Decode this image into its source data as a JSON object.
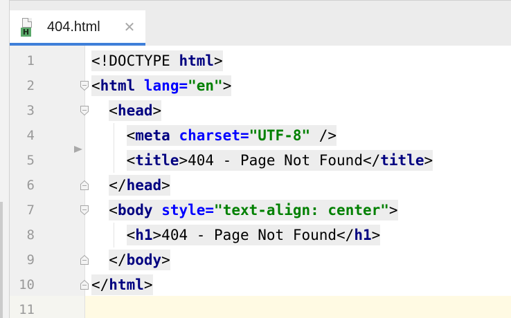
{
  "tab": {
    "filename": "404.html",
    "file_icon_letter": "H",
    "close_glyph": "✕"
  },
  "editor": {
    "line_numbers": [
      "1",
      "2",
      "3",
      "4",
      "5",
      "6",
      "7",
      "8",
      "9",
      "10",
      "11"
    ],
    "lines": [
      [
        {
          "t": "<!DOCTYPE ",
          "c": "plain"
        },
        {
          "t": "html",
          "c": "tag"
        },
        {
          "t": ">",
          "c": "plain"
        }
      ],
      [
        {
          "t": "<",
          "c": "plain"
        },
        {
          "t": "html",
          "c": "tag"
        },
        {
          "t": " ",
          "c": "plain"
        },
        {
          "t": "lang=",
          "c": "attr"
        },
        {
          "t": "\"en\"",
          "c": "str"
        },
        {
          "t": ">",
          "c": "plain"
        }
      ],
      [
        {
          "t": "  <",
          "c": "plain"
        },
        {
          "t": "head",
          "c": "tag"
        },
        {
          "t": ">",
          "c": "plain"
        }
      ],
      [
        {
          "t": "    <",
          "c": "plain"
        },
        {
          "t": "meta",
          "c": "tag"
        },
        {
          "t": " ",
          "c": "plain"
        },
        {
          "t": "charset=",
          "c": "attr"
        },
        {
          "t": "\"UTF-8\"",
          "c": "str"
        },
        {
          "t": " />",
          "c": "plain"
        }
      ],
      [
        {
          "t": "    <",
          "c": "plain"
        },
        {
          "t": "title",
          "c": "tag"
        },
        {
          "t": ">404 - Page Not Found</",
          "c": "plain"
        },
        {
          "t": "title",
          "c": "tag"
        },
        {
          "t": ">",
          "c": "plain"
        }
      ],
      [
        {
          "t": "  </",
          "c": "plain"
        },
        {
          "t": "head",
          "c": "tag"
        },
        {
          "t": ">",
          "c": "plain"
        }
      ],
      [
        {
          "t": "  <",
          "c": "plain"
        },
        {
          "t": "body",
          "c": "tag"
        },
        {
          "t": " ",
          "c": "plain"
        },
        {
          "t": "style=",
          "c": "attr"
        },
        {
          "t": "\"text-align: center\"",
          "c": "str"
        },
        {
          "t": ">",
          "c": "plain"
        }
      ],
      [
        {
          "t": "    <",
          "c": "plain"
        },
        {
          "t": "h1",
          "c": "tag"
        },
        {
          "t": ">404 - Page Not Found</",
          "c": "plain"
        },
        {
          "t": "h1",
          "c": "tag"
        },
        {
          "t": ">",
          "c": "plain"
        }
      ],
      [
        {
          "t": "  </",
          "c": "plain"
        },
        {
          "t": "body",
          "c": "tag"
        },
        {
          "t": ">",
          "c": "plain"
        }
      ],
      [
        {
          "t": "</",
          "c": "plain"
        },
        {
          "t": "html",
          "c": "tag"
        },
        {
          "t": ">",
          "c": "plain"
        }
      ],
      []
    ],
    "current_line": 11
  },
  "colors": {
    "tag": "#000080",
    "attribute": "#0000ff",
    "string": "#008000",
    "tab_accent": "#3f7fd9",
    "current_line": "#fffae3"
  }
}
